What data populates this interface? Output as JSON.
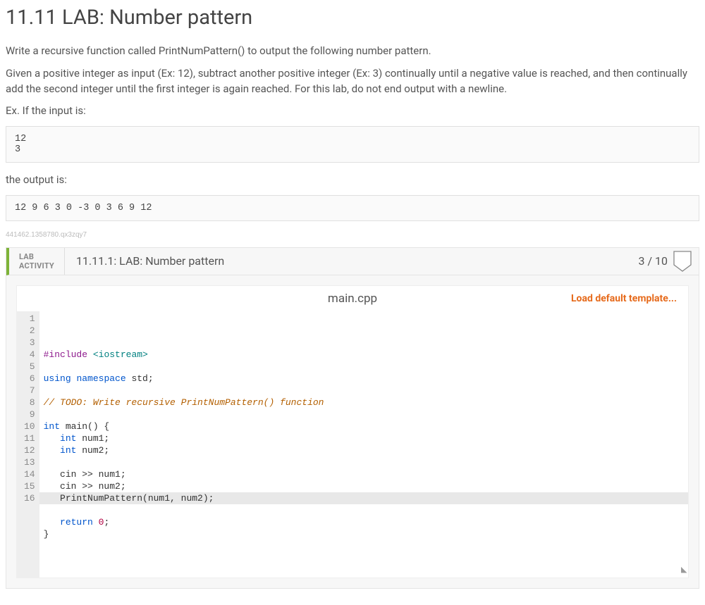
{
  "title": "11.11 LAB: Number pattern",
  "intro1": "Write a recursive function called PrintNumPattern() to output the following number pattern.",
  "intro2": "Given a positive integer as input (Ex: 12), subtract another positive integer (Ex: 3) continually until a negative value is reached, and then continually add the second integer until the first integer is again reached. For this lab, do not end output with a newline.",
  "ex_input_label": "Ex. If the input is:",
  "ex_input": "12\n3",
  "ex_output_label": "the output is:",
  "ex_output": "12 9 6 3 0 -3 0 3 6 9 12",
  "hash": "441462.1358780.qx3zqy7",
  "lab": {
    "activity_line1": "LAB",
    "activity_line2": "ACTIVITY",
    "title": "11.11.1: LAB: Number pattern",
    "score": "3 / 10"
  },
  "editor": {
    "filename": "main.cpp",
    "load_template": "Load default template...",
    "line_numbers": " 1\n 2\n 3\n 4\n 5\n 6\n 7\n 8\n 9\n10\n11\n12\n13\n14\n15\n16",
    "code_plain": "#include <iostream>\n\nusing namespace std;\n\n// TODO: Write recursive PrintNumPattern() function\n\nint main() {\n   int num1;\n   int num2;\n\n   cin >> num1;\n   cin >> num2;\n   PrintNumPattern(num1, num2);\n\n   return 0;\n}"
  }
}
